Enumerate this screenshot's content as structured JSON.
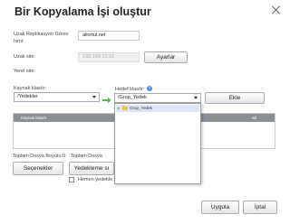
{
  "dialog": {
    "title": "Bir Kopyalama İşi oluştur"
  },
  "form": {
    "job_name_label": "Uzak Replikasyon Görev İsmi:",
    "job_name_value": "aliortul.net",
    "remote_site_label": "Uzak site:",
    "remote_site_value": "192.168.12.16",
    "settings_button": "Ayarlar",
    "local_site_label": "Yerel site:",
    "source_folder_label": "Kaynak klasör:",
    "source_folder_value": "/Yedekler",
    "target_folder_label": "Hedef klasör:",
    "target_folder_value": "/Grup_Yedek",
    "add_button": "Ekle"
  },
  "dropdown": {
    "items": [
      "Grup_Yedek"
    ]
  },
  "table": {
    "headers": [
      "Kaynak klasör",
      "Hedef klasör",
      "Sil"
    ]
  },
  "footer": {
    "total_size_label": "Toplam Dosya Boyutu:0",
    "total_count_label": "Toplam Dosya",
    "options_button": "Seçenekler",
    "schedule_button": "Yedekleme sı",
    "backup_now_label": "Hemen yedekle",
    "apply_button": "Uygula",
    "cancel_button": "İptal"
  }
}
